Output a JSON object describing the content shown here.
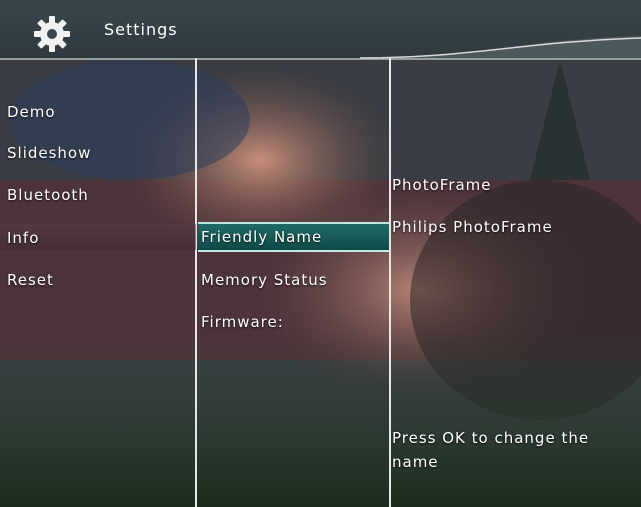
{
  "header": {
    "title": "Settings",
    "icon": "gear-icon"
  },
  "menu": {
    "items": [
      "Demo",
      "Slideshow",
      "Bluetooth",
      "Info",
      "Reset"
    ],
    "selected": "Info"
  },
  "submenu": {
    "items": [
      "Friendly Name",
      "Memory Status",
      "Firmware:"
    ],
    "selected": "Friendly Name"
  },
  "details": {
    "device_label": "PhotoFrame",
    "friendly_name": "Philips PhotoFrame",
    "help_line1": "Press OK to change the",
    "help_line2": "name"
  },
  "colors": {
    "highlight": "#1f6b66",
    "divider": "#e6e6e6",
    "text": "#ffffff"
  }
}
